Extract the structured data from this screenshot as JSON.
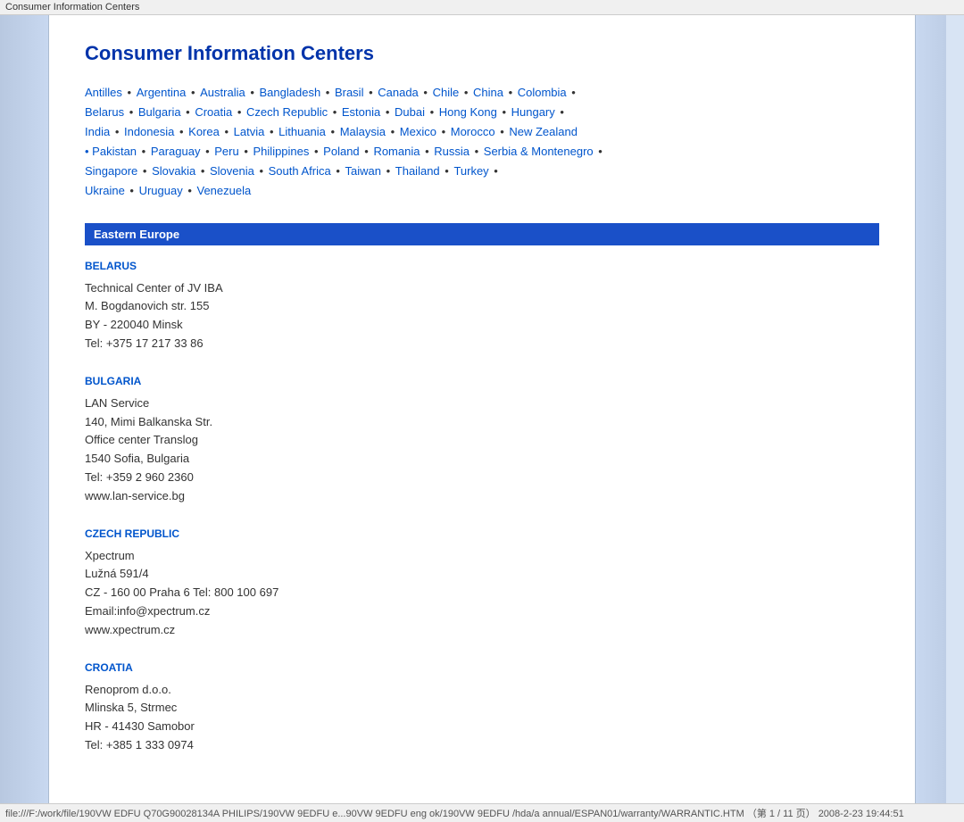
{
  "topbar": {
    "title": "Consumer Information Centers"
  },
  "page": {
    "title": "Consumer Information Centers"
  },
  "links": {
    "items": [
      "Antilles",
      "Argentina",
      "Australia",
      "Bangladesh",
      "Brasil",
      "Canada",
      "Chile",
      "China",
      "Colombia",
      "Belarus",
      "Bulgaria",
      "Croatia",
      "Czech Republic",
      "Estonia",
      "Dubai",
      "Hong Kong",
      "Hungary",
      "India",
      "Indonesia",
      "Korea",
      "Latvia",
      "Lithuania",
      "Malaysia",
      "Mexico",
      "Morocco",
      "New Zealand",
      "Pakistan",
      "Paraguay",
      "Peru",
      "Philippines",
      "Poland",
      "Romania",
      "Russia",
      "Serbia & Montenegro",
      "Singapore",
      "Slovakia",
      "Slovenia",
      "South Africa",
      "Taiwan",
      "Thailand",
      "Turkey",
      "Ukraine",
      "Uruguay",
      "Venezuela"
    ]
  },
  "section_header": "Eastern Europe",
  "countries": [
    {
      "name": "BELARUS",
      "details": "Technical Center of JV IBA\nM. Bogdanovich str. 155\nBY - 220040 Minsk\nTel: +375 17 217 33 86"
    },
    {
      "name": "BULGARIA",
      "details": "LAN Service\n140, Mimi Balkanska Str.\nOffice center Translog\n1540 Sofia, Bulgaria\nTel: +359 2 960 2360\nwww.lan-service.bg"
    },
    {
      "name": "CZECH REPUBLIC",
      "details": "Xpectrum\nLužná 591/4\nCZ - 160 00 Praha 6 Tel: 800 100 697\nEmail:info@xpectrum.cz\nwww.xpectrum.cz"
    },
    {
      "name": "CROATIA",
      "details": "Renoprom d.o.o.\nMlinska 5, Strmec\nHR - 41430 Samobor\nTel: +385 1 333 0974"
    }
  ],
  "bottombar": {
    "text": "file:///F:/work/file/190VW EDFU Q70G90028134A PHILIPS/190VW 9EDFU e...90VW 9EDFU eng ok/190VW 9EDFU /hda/a annual/ESPAN01/warranty/WARRANTIC.HTM （第 1 / 11 页） 2008-2-23 19:44:51"
  }
}
